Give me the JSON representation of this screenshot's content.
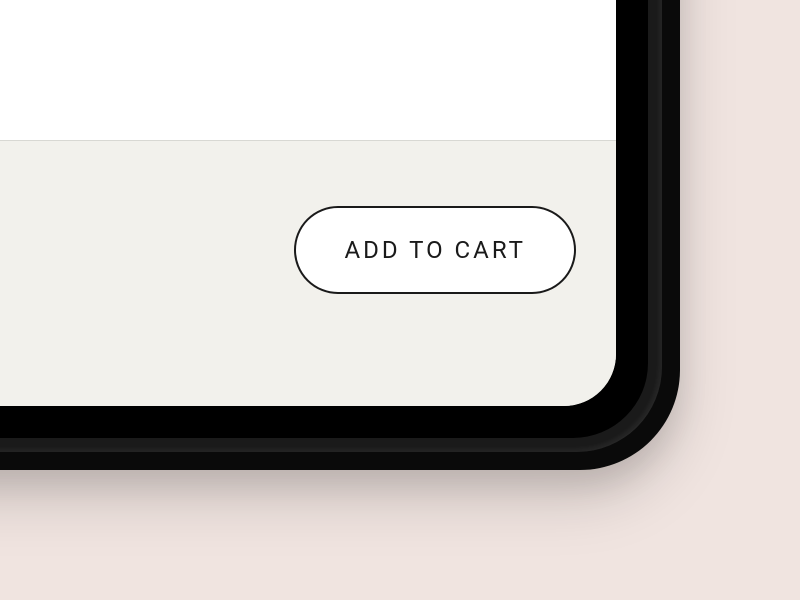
{
  "actions": {
    "add_to_cart_label": "ADD TO CART"
  }
}
